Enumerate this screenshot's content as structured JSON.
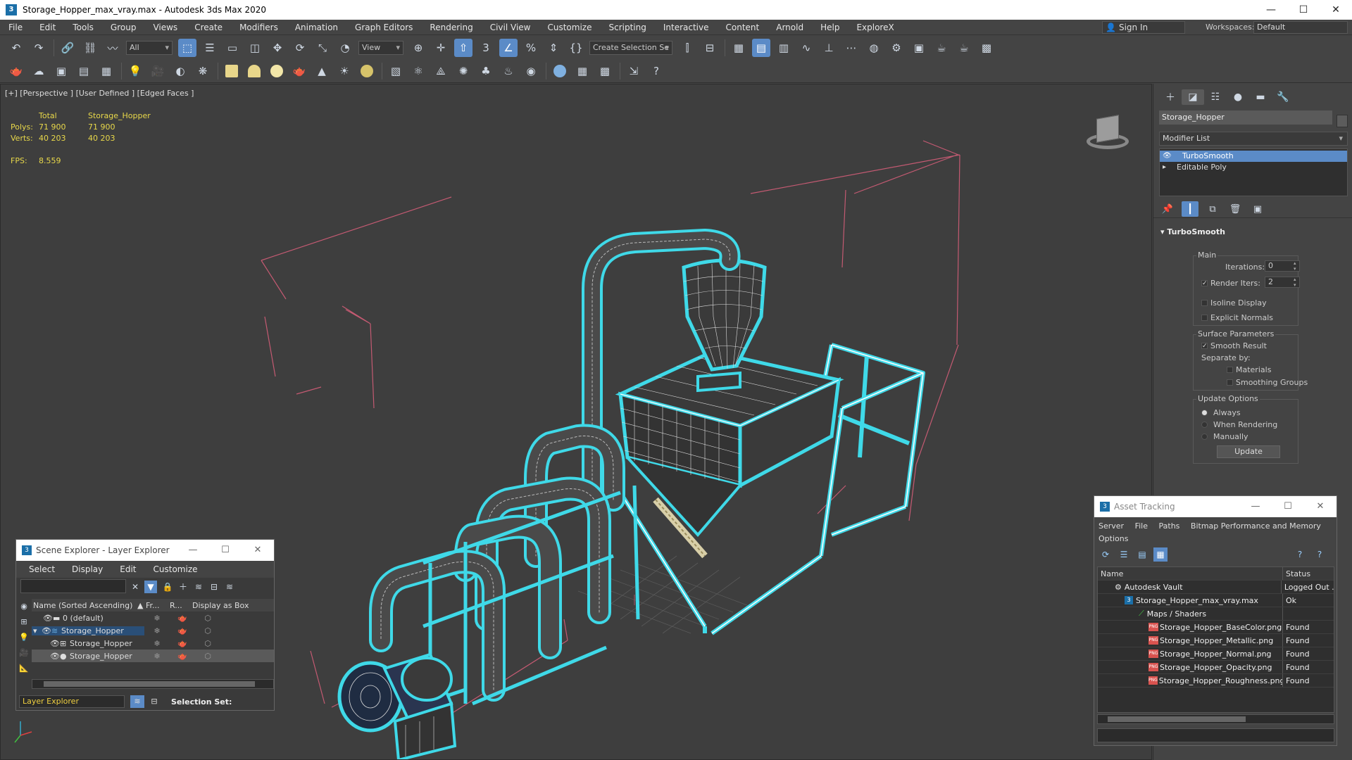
{
  "window": {
    "title": "Storage_Hopper_max_vray.max - Autodesk 3ds Max 2020",
    "controls": [
      "—",
      "☐",
      "✕"
    ]
  },
  "menu": {
    "items": [
      "File",
      "Edit",
      "Tools",
      "Group",
      "Views",
      "Create",
      "Modifiers",
      "Animation",
      "Graph Editors",
      "Rendering",
      "Civil View",
      "Customize",
      "Scripting",
      "Interactive",
      "Content",
      "Arnold",
      "Help",
      "ExploreX"
    ],
    "sign_in": "Sign In",
    "workspaces_label": "Workspaces:",
    "workspace_value": "Default"
  },
  "toolbar": {
    "selection_filter": "All",
    "ref_coord": "View",
    "selection_set": "Create Selection Se"
  },
  "viewport": {
    "label": "[+] [Perspective ] [User Defined ] [Edged Faces ]",
    "stats": {
      "total_label": "Total",
      "object_label": "Storage_Hopper",
      "polys_label": "Polys:",
      "polys_total": "71 900",
      "polys_object": "71 900",
      "verts_label": "Verts:",
      "verts_total": "40 203",
      "verts_object": "40 203",
      "fps_label": "FPS:",
      "fps_value": "8.559"
    }
  },
  "command_panel": {
    "object_name": "Storage_Hopper",
    "modifier_list": "Modifier List",
    "stack": [
      "TurboSmooth",
      "Editable Poly"
    ],
    "rollout_title": "TurboSmooth",
    "main_group": "Main",
    "iterations_label": "Iterations:",
    "iterations_value": "0",
    "render_iters_label": "Render Iters:",
    "render_iters_value": "2",
    "isoline_display": "Isoline Display",
    "explicit_normals": "Explicit Normals",
    "surface_group": "Surface Parameters",
    "smooth_result": "Smooth Result",
    "separate_by": "Separate by:",
    "materials": "Materials",
    "smoothing_groups": "Smoothing Groups",
    "update_group": "Update Options",
    "always": "Always",
    "when_rendering": "When Rendering",
    "manually": "Manually",
    "update_button": "Update"
  },
  "scene_explorer": {
    "title": "Scene Explorer - Layer Explorer",
    "menu": [
      "Select",
      "Display",
      "Edit",
      "Customize"
    ],
    "columns": [
      "Name (Sorted Ascending)",
      "▲ Fr...",
      "R...",
      "Display as Box"
    ],
    "rows": [
      {
        "name": "0 (default)"
      },
      {
        "name": "Storage_Hopper"
      },
      {
        "name": "Storage_Hopper"
      },
      {
        "name": "Storage_Hopper"
      }
    ],
    "footer_layer": "Layer Explorer",
    "selection_set": "Selection Set:"
  },
  "asset_tracking": {
    "title": "Asset Tracking",
    "menu_line1": [
      "Server",
      "File",
      "Paths",
      "Bitmap Performance and Memory"
    ],
    "menu_line2": "Options",
    "columns": [
      "Name",
      "Status"
    ],
    "rows": [
      {
        "name": "Autodesk Vault",
        "status": "Logged Out ."
      },
      {
        "name": "Storage_Hopper_max_vray.max",
        "status": "Ok"
      },
      {
        "name": "Maps / Shaders",
        "status": ""
      },
      {
        "name": "Storage_Hopper_BaseColor.png",
        "status": "Found"
      },
      {
        "name": "Storage_Hopper_Metallic.png",
        "status": "Found"
      },
      {
        "name": "Storage_Hopper_Normal.png",
        "status": "Found"
      },
      {
        "name": "Storage_Hopper_Opacity.png",
        "status": "Found"
      },
      {
        "name": "Storage_Hopper_Roughness.png",
        "status": "Found"
      }
    ]
  },
  "colors": {
    "accent": "#5b8bc7",
    "stats_text": "#e8d84a",
    "wire_highlight": "#3fd9e8",
    "bbox_lines": "#c45a72"
  }
}
